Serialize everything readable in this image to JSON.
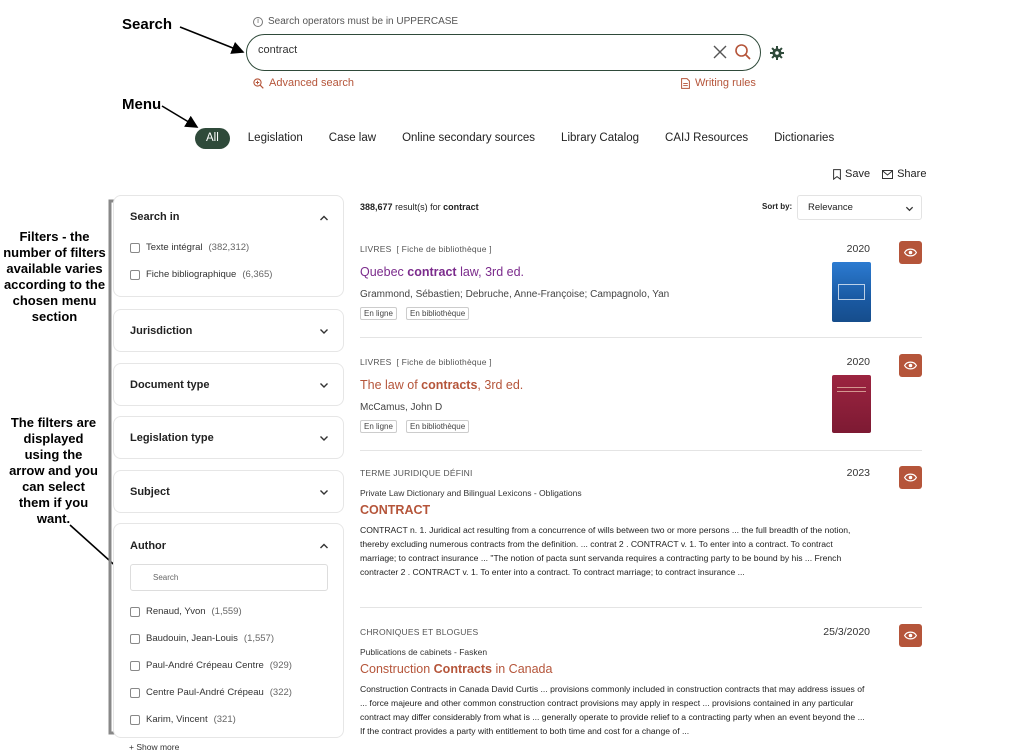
{
  "annotations": {
    "search": "Search",
    "menu": "Menu",
    "filters": "Filters - the number of filters available varies according to the chosen menu section",
    "filters_display": "The filters are displayed using the arrow and you can select them if you want."
  },
  "search": {
    "hint": "Search operators must be in UPPERCASE",
    "value": "contract",
    "advanced": "Advanced search",
    "writing_rules": "Writing rules"
  },
  "tabs": [
    "All",
    "Legislation",
    "Case law",
    "Online secondary sources",
    "Library Catalog",
    "CAIJ Resources",
    "Dictionaries"
  ],
  "actions": {
    "save": "Save",
    "share": "Share"
  },
  "filters": {
    "search_in": {
      "title": "Search in",
      "options": [
        {
          "label": "Texte intégral",
          "count": "(382,312)"
        },
        {
          "label": "Fiche bibliographique",
          "count": "(6,365)"
        }
      ]
    },
    "collapsed": [
      "Jurisdiction",
      "Document type",
      "Legislation type",
      "Subject"
    ],
    "author": {
      "title": "Author",
      "search_placeholder": "Search",
      "options": [
        {
          "label": "Renaud, Yvon",
          "count": "(1,559)"
        },
        {
          "label": "Baudouin, Jean-Louis",
          "count": "(1,557)"
        },
        {
          "label": "Paul-André Crépeau Centre",
          "count": "(929)"
        },
        {
          "label": "Centre Paul-André Crépeau",
          "count": "(322)"
        },
        {
          "label": "Karim, Vincent",
          "count": "(321)"
        }
      ],
      "show_more": "+ Show more"
    }
  },
  "results_header": {
    "count": "388,677",
    "count_suffix": "result(s) for",
    "query": "contract",
    "sort_label": "Sort by:",
    "sort_value": "Relevance"
  },
  "results": [
    {
      "type": "LIVRES  [ Fiche de bibliothèque ]",
      "year": "2020",
      "title_pre": "Quebec ",
      "title_bold": "contract",
      "title_post": " law, 3rd ed.",
      "title_color": "#7b2b8c",
      "authors": "Grammond, Sébastien; Debruche, Anne-Françoise; Campagnolo, Yan",
      "chips": [
        "En ligne",
        "En bibliothèque"
      ],
      "cover_color": "#1f5fa8"
    },
    {
      "type": "LIVRES  [ Fiche de bibliothèque ]",
      "year": "2020",
      "title_pre": "The law of ",
      "title_bold": "contracts",
      "title_post": ", 3rd ed.",
      "title_color": "#b5553a",
      "authors": "McCamus, John D",
      "chips": [
        "En ligne",
        "En bibliothèque"
      ],
      "cover_color": "#8a1d35"
    },
    {
      "type": "TERME JURIDIQUE DÉFINI",
      "year": "2023",
      "subtitle": "Private Law Dictionary and Bilingual Lexicons - Obligations",
      "title": "CONTRACT",
      "excerpt": "CONTRACT n. 1. Juridical act resulting from a concurrence of wills between two or more persons ... the full breadth of the notion, thereby excluding numerous contracts from the definition. ... contrat 2 . CONTRACT v. 1. To enter into a contract. To contract marriage; to contract insurance ... \"The notion of pacta sunt servanda requires a contracting party to be bound by his ... French contracter 2 . CONTRACT v. 1. To enter into a contract. To contract marriage; to contract insurance ..."
    },
    {
      "type": "CHRONIQUES ET BLOGUES",
      "year": "25/3/2020",
      "subtitle": "Publications de cabinets - Fasken",
      "title_pre": "Construction ",
      "title_bold": "Contracts",
      "title_post": " in Canada",
      "excerpt": "Construction Contracts in Canada David Curtis ... provisions commonly included in construction contracts that may address issues of ... force majeure and other common construction contract provisions may apply in respect ... provisions contained in any particular contract may differ considerably from what is ... generally operate to provide relief to a contracting party when an event beyond the ... If the contract provides a party with entitlement to both time and cost for a change of ..."
    }
  ],
  "colors": {
    "accent": "#b5553a",
    "brand_green": "#2f4a3a"
  }
}
